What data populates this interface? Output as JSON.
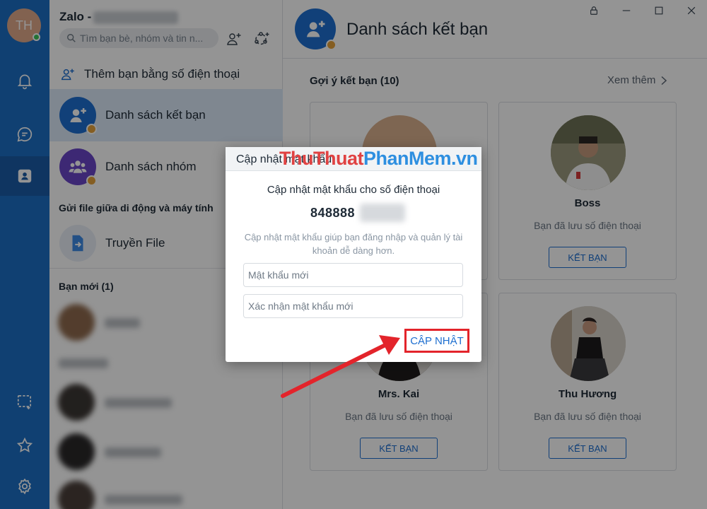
{
  "sidebar": {
    "avatar_initials": "TH",
    "icons": [
      "bell-icon",
      "chat-icon",
      "contacts-icon",
      "screenshot-icon",
      "star-icon",
      "gear-icon"
    ]
  },
  "panel": {
    "app_title": "Zalo -",
    "search_placeholder": "Tìm bạn bè, nhóm và tin n...",
    "add_by_phone": "Thêm bạn bằng số điện thoại",
    "friends_list": "Danh sách kết bạn",
    "groups_list": "Danh sách nhóm",
    "send_file_section": "Gửi file giữa di động và máy tính",
    "transfer_file": "Truyền File",
    "new_friends": "Bạn mới (1)"
  },
  "main": {
    "title": "Danh sách kết bạn",
    "suggestions": "Gợi ý kết bạn (10)",
    "see_more": "Xem thêm",
    "cards": [
      {
        "name": "",
        "subtitle": "",
        "button": ""
      },
      {
        "name": "Boss",
        "subtitle": "Bạn đã lưu số điện thoại",
        "button": "KẾT BẠN"
      },
      {
        "name": "Mrs. Kai",
        "subtitle": "Bạn đã lưu số điện thoại",
        "button": "KẾT BẠN"
      },
      {
        "name": "Thu Hương",
        "subtitle": "Bạn đã lưu số điện thoại",
        "button": "KẾT BẠN"
      }
    ]
  },
  "dialog": {
    "title": "Cập nhật mật khẩu",
    "subtitle": "Cập nhật mật khẩu cho số điện thoại",
    "phone": "848888",
    "description": "Cập nhật mật khẩu giúp bạn đăng nhập và quản lý tài khoản dễ dàng hơn.",
    "new_password_placeholder": "Mật khẩu mới",
    "confirm_password_placeholder": "Xác nhận mật khẩu mới",
    "update_button": "CẬP NHẬT"
  },
  "watermark": {
    "part1": "Thu",
    "part2": "Thuat",
    "part3": "PhanMem",
    "part4": ".vn"
  },
  "colors": {
    "rail": "#1d6fc5",
    "accent": "#1e6fd0",
    "highlight": "#e3242b"
  }
}
